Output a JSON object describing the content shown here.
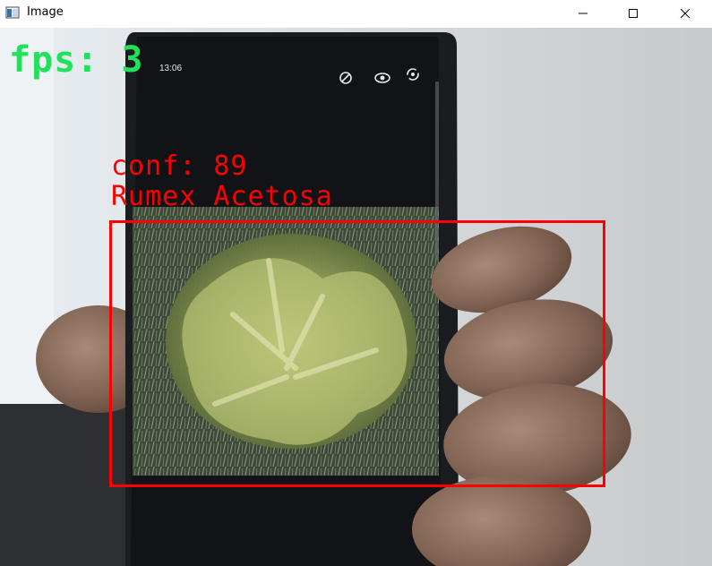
{
  "window": {
    "title": "Image",
    "icons": [
      "app-window-icon",
      "minimize-icon",
      "maximize-icon",
      "close-icon"
    ]
  },
  "overlay": {
    "fps_text": "fps: 3",
    "conf_text": "conf: 89",
    "class_label": "Rumex Acetosa",
    "fps_color": "#1ee35a",
    "detection_color": "#ff0000"
  },
  "phone": {
    "status_time": "13:06",
    "icons": [
      "rotate-icon",
      "eye-icon",
      "sync-icon"
    ]
  }
}
